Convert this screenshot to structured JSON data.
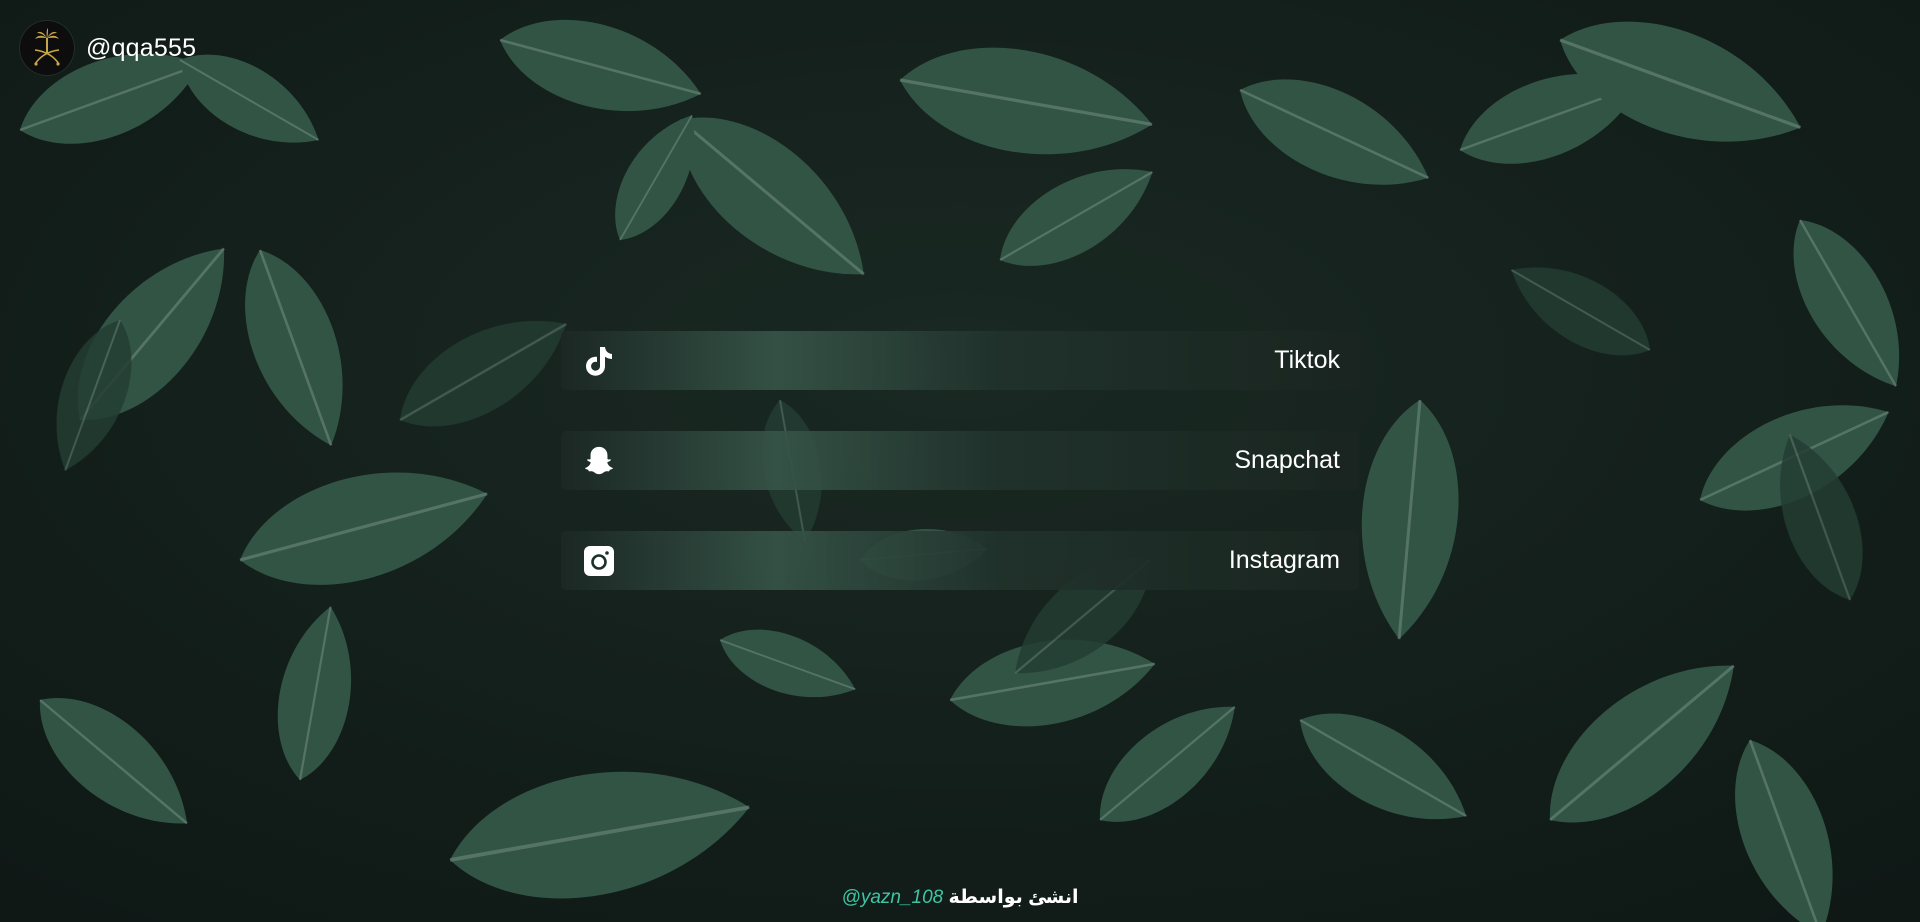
{
  "profile": {
    "username": "@qqa555",
    "avatar_icon": "emblem-palm-swords-icon"
  },
  "links": [
    {
      "label": "Tiktok",
      "icon": "tiktok-icon"
    },
    {
      "label": "Snapchat",
      "icon": "snapchat-ghost-icon"
    },
    {
      "label": "Instagram",
      "icon": "instagram-icon"
    }
  ],
  "footer": {
    "handle": "@yazn_108",
    "credit": "انشئ بواسطة"
  },
  "colors": {
    "background": "#1b2a25",
    "button": "#22332d",
    "accent": "#3ec6a4",
    "emblem": "#c9a54a"
  }
}
